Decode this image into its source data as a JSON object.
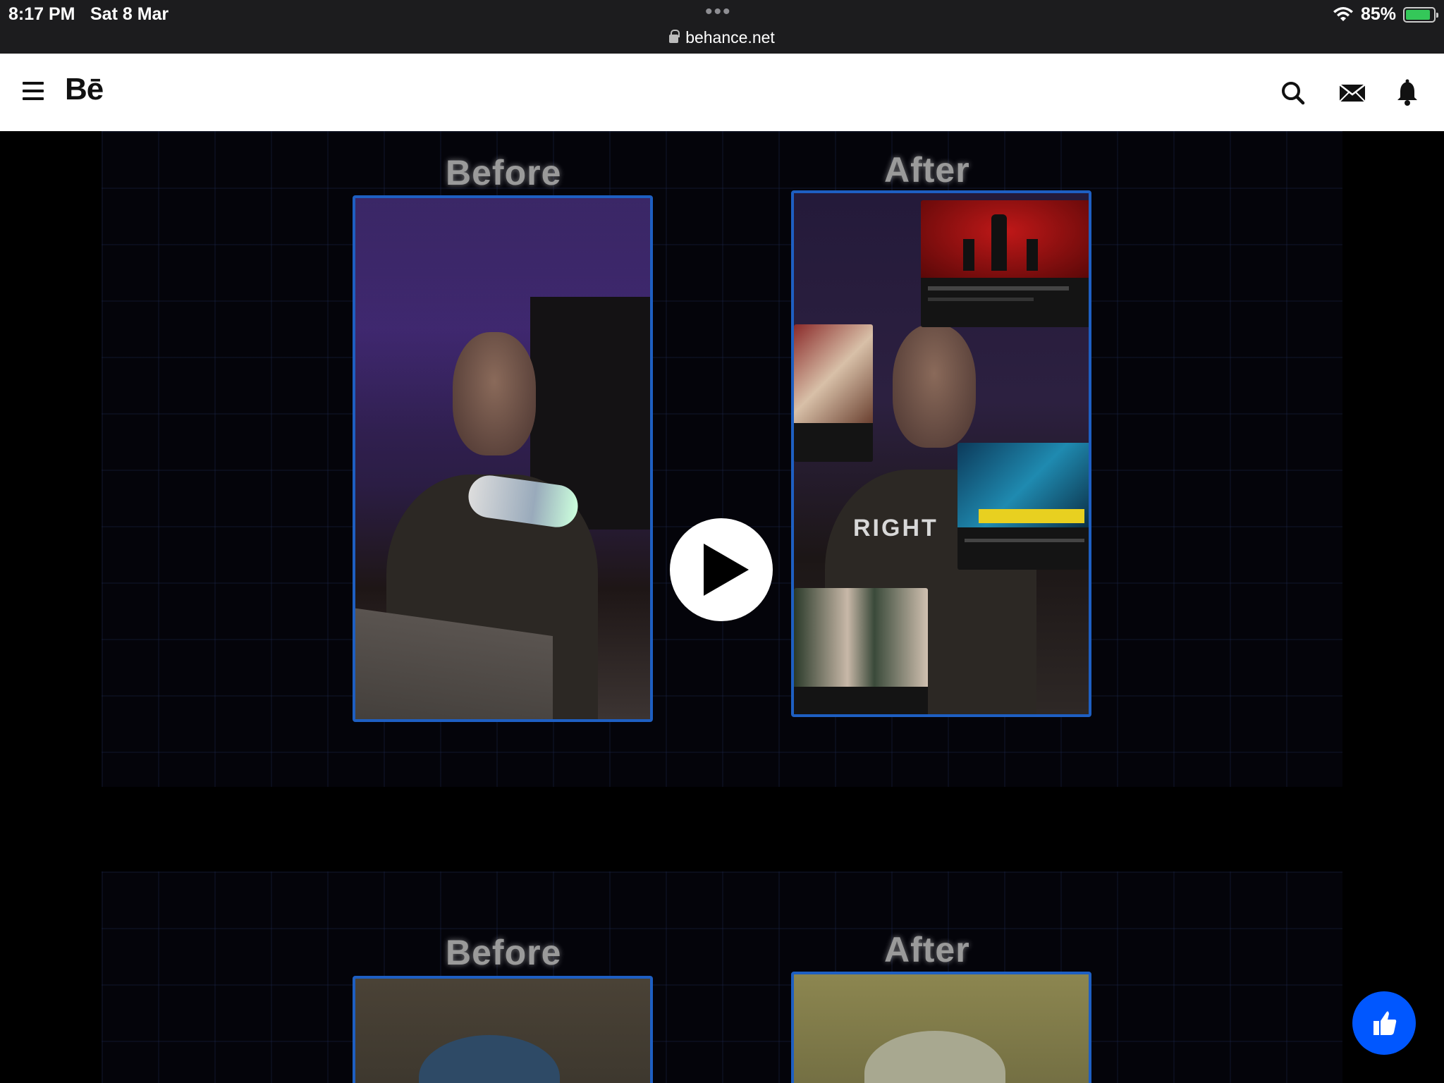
{
  "status_bar": {
    "time": "8:17 PM",
    "date": "Sat 8 Mar",
    "battery": "85%",
    "url": "behance.net"
  },
  "header": {
    "logo": "Bē",
    "icons": [
      "menu-icon",
      "search-icon",
      "mail-icon",
      "bell-icon"
    ]
  },
  "project": {
    "section1": {
      "before_label": "Before",
      "after_label": "After",
      "overlay_text": "RIGHT"
    },
    "section2": {
      "before_label": "Before",
      "after_label": "After"
    }
  },
  "colors": {
    "accent": "#0057ff",
    "frame_border": "#1e5fc2",
    "header_bg": "#ffffff"
  }
}
